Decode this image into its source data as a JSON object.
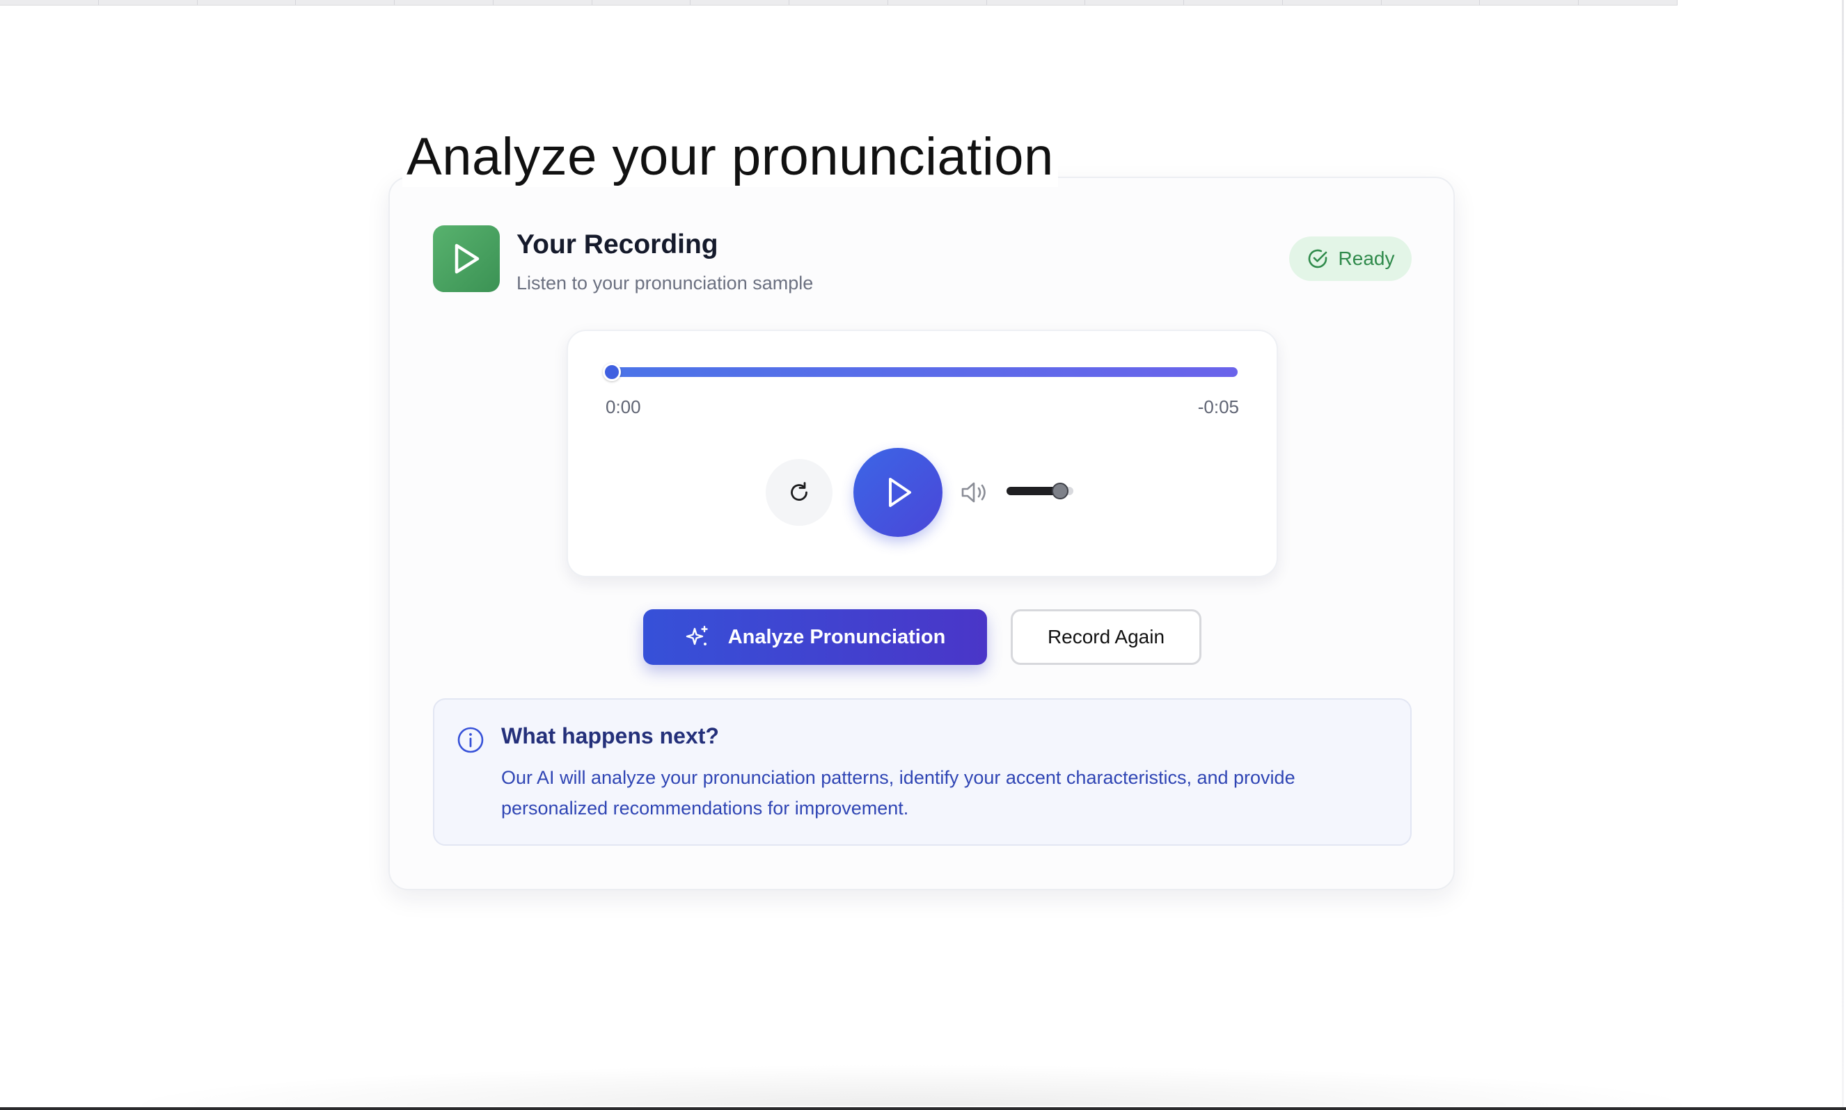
{
  "page": {
    "title": "Analyze your pronunciation"
  },
  "recording": {
    "icon": "play-icon",
    "title": "Your Recording",
    "subtitle": "Listen to your pronunciation sample",
    "status": {
      "label": "Ready",
      "icon": "check-circle-icon",
      "color": "#2f8a4b",
      "background": "#e3f5e7"
    }
  },
  "player": {
    "current_time": "0:00",
    "remaining_time": "-0:05",
    "progress_fraction": 0,
    "volume_fraction": 0.8,
    "controls": {
      "restart_icon": "restart-icon",
      "play_icon": "play-icon",
      "volume_icon": "volume-icon"
    },
    "accent_colors": [
      "#3c66e6",
      "#4a46d8"
    ]
  },
  "actions": {
    "analyze": {
      "label": "Analyze Pronunciation",
      "icon": "sparkles-icon"
    },
    "record_again": {
      "label": "Record Again"
    }
  },
  "info": {
    "icon": "info-icon",
    "title": "What happens next?",
    "text": "Our AI will analyze your pronunciation patterns, identify your accent characteristics, and provide personalized recommendations for improvement."
  }
}
